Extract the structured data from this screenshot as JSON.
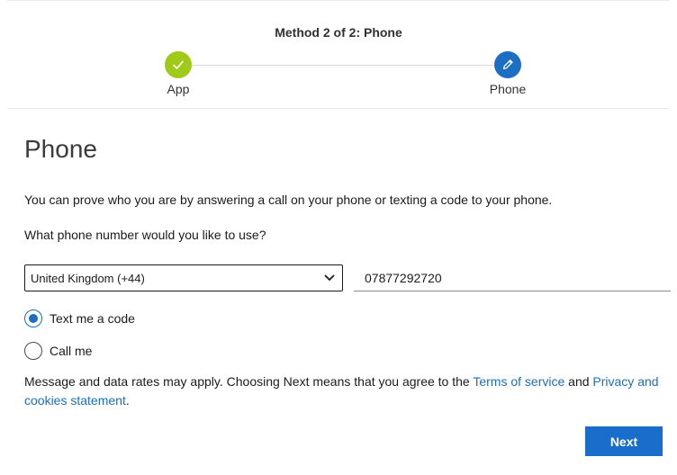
{
  "progress": {
    "title": "Method 2 of 2: Phone",
    "steps": [
      {
        "label": "App",
        "state": "complete",
        "icon": "checkmark-icon"
      },
      {
        "label": "Phone",
        "state": "current",
        "icon": "pencil-icon"
      }
    ]
  },
  "page": {
    "title": "Phone",
    "description": "You can prove who you are by answering a call on your phone or texting a code to your phone.",
    "question": "What phone number would you like to use?"
  },
  "country_select": {
    "selected": "United Kingdom (+44)"
  },
  "phone_input": {
    "value": "07877292720"
  },
  "options": [
    {
      "label": "Text me a code",
      "checked": true
    },
    {
      "label": "Call me",
      "checked": false
    }
  ],
  "disclaimer": {
    "before": "Message and data rates may apply. Choosing Next means that you agree to the ",
    "terms_link": "Terms of service",
    "middle": " and ",
    "privacy_link": "Privacy and cookies statement",
    "end": "."
  },
  "actions": {
    "next_label": "Next"
  },
  "colors": {
    "accent": "#1b6ec2",
    "complete": "#9fca1a"
  }
}
